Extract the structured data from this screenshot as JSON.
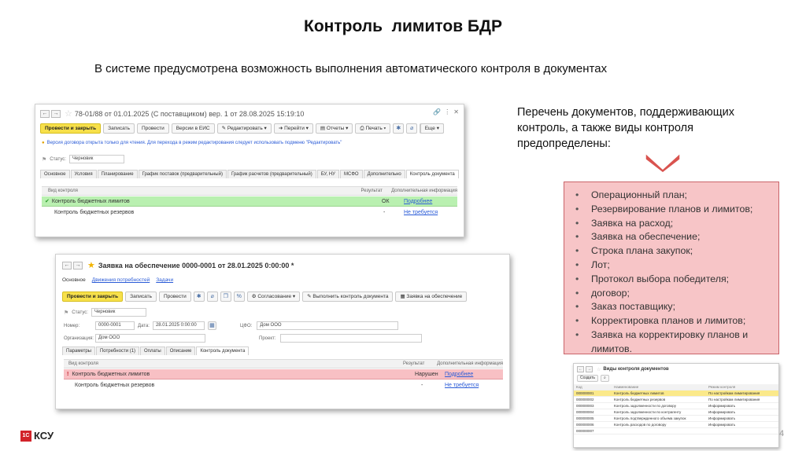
{
  "slide": {
    "title": "Контроль  лимитов БДР",
    "subtitle": "В системе предусмотрена возможность выполнения автоматического контроля в документах",
    "right_text": "Перечень документов, поддерживающих контроль, а также виды контроля предопределены:",
    "list": [
      "Операционный план;",
      "Резервирование планов и лимитов;",
      "Заявка на расход;",
      "Заявка на обеспечение;",
      "Строка плана закупок;",
      "Лот;",
      "Протокол выбора победителя;",
      "договор;",
      "Заказ поставщику;",
      "Корректировка планов и лимитов;",
      "Заявка на корректировку планов и лимитов."
    ],
    "logo_text": "КСУ",
    "logo_mark": "1С",
    "page_number": "4",
    "colors": {
      "accent": "#f7e04a",
      "box_fill": "#f7c5c7",
      "box_border": "#c9646a",
      "arrow": "#d9534f"
    }
  },
  "window1": {
    "title": "78-01/88 от 01.01.2025 (С поставщиком) вер. 1 от 28.08.2025 15:19:10",
    "toolbar": {
      "post_close": "Провести и закрыть",
      "save": "Записать",
      "post": "Провести",
      "eis_version": "Версии в ЕИС",
      "edit": "Редактировать",
      "goto": "Перейти",
      "reports": "Отчеты",
      "print": "Печать",
      "more": "Еще"
    },
    "info_text": "Версия договора открыта только для чтения. Для перехода в режим редактирования следует использовать подменю \"Редактировать\"",
    "status_label": "Статус:",
    "status_value": "Черновик",
    "tabs": [
      "Основное",
      "Условия",
      "Планирование",
      "График поставок (предварительный)",
      "График расчетов (предварительный)",
      "БУ, НУ",
      "МСФО",
      "Дополнительно",
      "Контроль документа"
    ],
    "grid_headers": {
      "kind": "Вид контроля",
      "result": "Результат",
      "extra": "Дополнительная информация"
    },
    "rows": [
      {
        "kind": "Контроль бюджетных лимитов",
        "result": "ОК",
        "extra": "Подробнее"
      },
      {
        "kind": "Контроль бюджетных резервов",
        "result": "-",
        "extra": "Не требуется"
      }
    ]
  },
  "window2": {
    "title": "Заявка на обеспечение 0000-0001 от 28.01.2025 0:00:00 *",
    "nav": [
      "Основное",
      "Движения потребностей",
      "Задачи"
    ],
    "toolbar": {
      "post_close": "Провести и закрыть",
      "save": "Записать",
      "post": "Провести",
      "approval": "Согласование",
      "run_control": "Выполнить контроль документа",
      "request": "Заявка на обеспечение"
    },
    "status_label": "Статус:",
    "status_value": "Черновик",
    "fields": {
      "number_label": "Номер:",
      "number_value": "0000-0001",
      "date_label": "Дата:",
      "date_value": "28.01.2025  0:00:00",
      "cfo_label": "ЦФО:",
      "cfo_value": "Дом ООО",
      "org_label": "Организация:",
      "org_value": "Дом ООО",
      "project_label": "Проект:"
    },
    "tabs": [
      "Параметры",
      "Потребности (1)",
      "Оплаты",
      "Описание",
      "Контроль документа"
    ],
    "grid_headers": {
      "kind": "Вид контроля",
      "result": "Результат",
      "extra": "Дополнительная информация"
    },
    "rows": [
      {
        "kind": "Контроль бюджетных лимитов",
        "result": "Нарушен",
        "extra": "Подробнее"
      },
      {
        "kind": "Контроль бюджетных резервов",
        "result": "-",
        "extra": "Не требуется"
      }
    ]
  },
  "mini": {
    "title": "Виды контроля документов",
    "create": "Создать",
    "headers": [
      "Код",
      "Наименование",
      "Режим контроля"
    ],
    "rows": [
      [
        "000000001",
        "Контроль бюджетных лимитов",
        "По настройкам лимитирования"
      ],
      [
        "000000002",
        "Контроль бюджетных резервов",
        "По настройкам лимитирования"
      ],
      [
        "000000003",
        "Контроль задолженности по договору",
        "Информировать"
      ],
      [
        "000000004",
        "Контроль задолженности по контрагенту",
        "Информировать"
      ],
      [
        "000000005",
        "Контроль подтвержденного объема закупок",
        "Информировать"
      ],
      [
        "000000006",
        "Контроль расходов по договору",
        "Информировать"
      ],
      [
        "000000007",
        "",
        ""
      ]
    ]
  }
}
